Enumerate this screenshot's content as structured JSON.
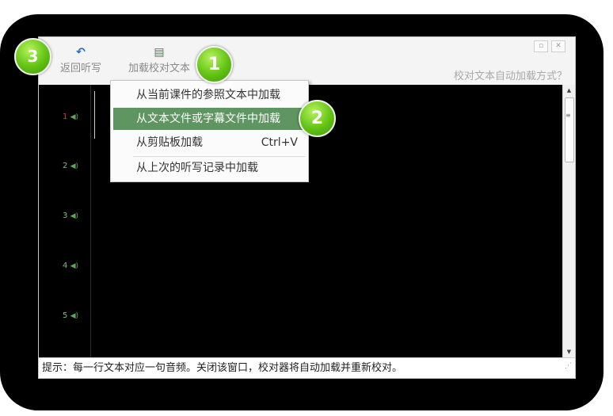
{
  "toolbar": {
    "back_label": "返回听写",
    "load_label": "加载校对文本",
    "help_link": "校对文本自动加载方式？"
  },
  "menu": {
    "items": [
      {
        "label": "从当前课件的参照文本中加载",
        "shortcut": ""
      },
      {
        "label": "从文本文件或字幕文件中加载",
        "shortcut": ""
      },
      {
        "label": "从剪贴板加载",
        "shortcut": "Ctrl+V"
      },
      {
        "label": "从上次的听写记录中加载",
        "shortcut": ""
      }
    ],
    "highlighted_index": 1
  },
  "editor": {
    "lines": [
      {
        "num": "1",
        "active": true
      },
      {
        "num": "2",
        "active": false
      },
      {
        "num": "3",
        "active": false
      },
      {
        "num": "4",
        "active": false
      },
      {
        "num": "5",
        "active": false
      }
    ]
  },
  "status": {
    "text": "提示：每一行文本对应一句音频。关闭该窗口，校对器将自动加载并重新校对。"
  },
  "badges": [
    "1",
    "2",
    "3"
  ],
  "icons": {
    "back": "back-arrow-icon",
    "load": "load-text-icon",
    "speaker": "speaker-icon"
  },
  "colors": {
    "highlight": "#5f9560",
    "active_line_number": "#d83a3a",
    "badge_green": "#62c214",
    "editor_background": "#000000"
  }
}
